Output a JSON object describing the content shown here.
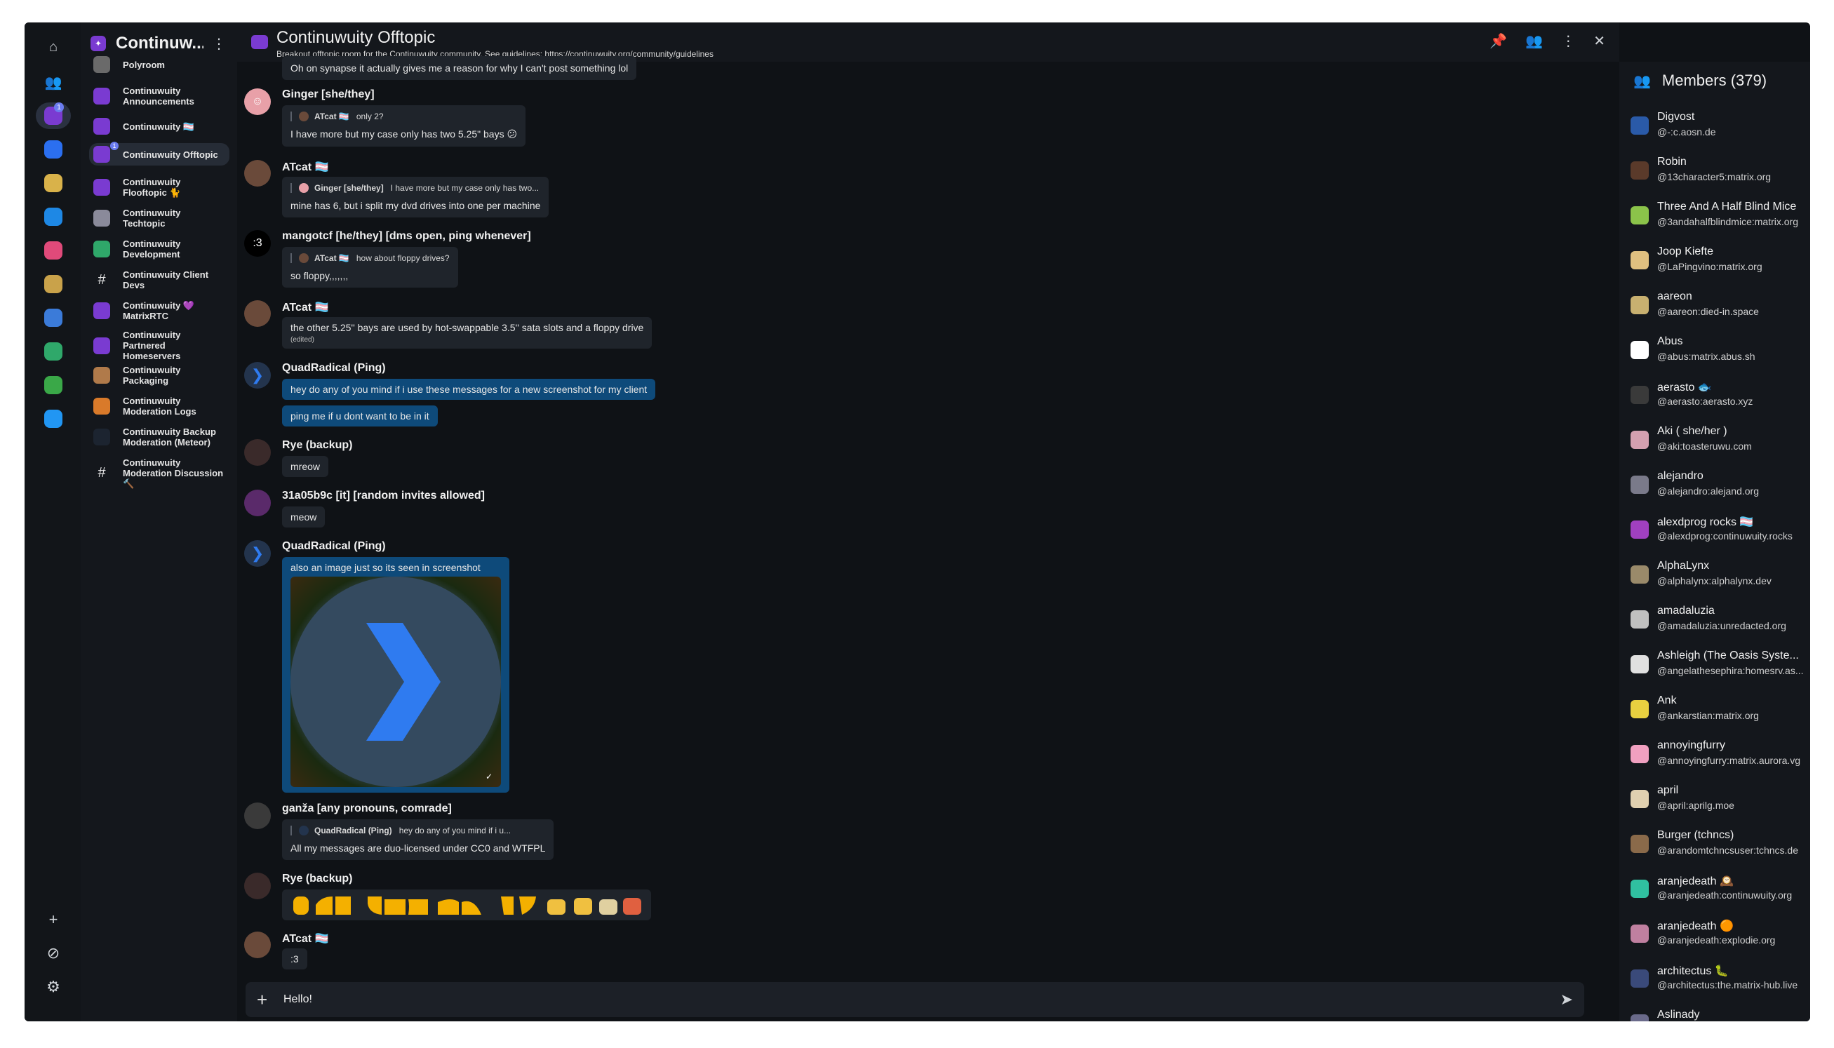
{
  "space": {
    "name": "Continuw...",
    "menu_icon": "kebab-icon"
  },
  "rail": [
    {
      "icon": "home-icon",
      "glyph": "⌂",
      "color": "#cfd3d8"
    },
    {
      "icon": "people-icon",
      "glyph": "👥",
      "color": "#cfd3d8"
    },
    {
      "icon": "continuwuity-space-icon",
      "color": "#7a3bd1",
      "badge": "1",
      "active": true
    },
    {
      "icon": "chat-space-icon",
      "color": "#2b6ff0"
    },
    {
      "icon": "globe-space-icon",
      "color": "#d9b24a"
    },
    {
      "icon": "arrow-space-icon",
      "color": "#1e88e5"
    },
    {
      "icon": "bubble-space-icon",
      "color": "#e04a7a"
    },
    {
      "icon": "tag-space-icon",
      "color": "#c9a24a"
    },
    {
      "icon": "snowflake-space-icon",
      "color": "#3b7bd9"
    },
    {
      "icon": "triangle-space-icon",
      "color": "#2fa86a"
    },
    {
      "icon": "green-space-icon",
      "color": "#3aa848"
    },
    {
      "icon": "bird-space-icon",
      "color": "#2196f3"
    }
  ],
  "rail_bottom": [
    {
      "icon": "add-space-icon",
      "glyph": "+"
    },
    {
      "icon": "explore-icon",
      "glyph": "⊘"
    },
    {
      "icon": "settings-icon",
      "glyph": "⚙"
    }
  ],
  "rooms": [
    {
      "label": "Polyroom",
      "color": "#6a6a6a"
    },
    {
      "label": "Continuwuity Announcements",
      "color": "#7a3bd1"
    },
    {
      "label": "Continuwuity 🏳️‍⚧️",
      "color": "#7a3bd1"
    },
    {
      "label": "Continuwuity Offtopic",
      "color": "#7a3bd1",
      "active": true,
      "badge": "1"
    },
    {
      "label": "Continuwuity Flooftopic 🐈",
      "color": "#7a3bd1"
    },
    {
      "label": "Continuwuity Techtopic",
      "color": "#8a8a9a"
    },
    {
      "label": "Continuwuity Development",
      "color": "#2fa86a"
    },
    {
      "label": "Continuwuity Client Devs",
      "color": "transparent",
      "hash": true
    },
    {
      "label": "Continuwuity 💜 MatrixRTC",
      "color": "#7a3bd1"
    },
    {
      "label": "Continuwuity Partnered Homeservers",
      "color": "#7a3bd1"
    },
    {
      "label": "Continuwuity Packaging",
      "color": "#b07a4a"
    },
    {
      "label": "Continuwuity Moderation Logs",
      "color": "#d97a2a"
    },
    {
      "label": "Continuwuity Backup Moderation (Meteor)",
      "color": "#1c2430"
    },
    {
      "label": "Continuwuity Moderation Discussion 🔨",
      "color": "transparent",
      "hash": true
    }
  ],
  "room": {
    "title": "Continuwuity Offtopic",
    "topic": "Breakout offtopic room for the Continuwuity community. See guidelines: https://continuwuity.org/community/guidelines"
  },
  "messages": {
    "m0": {
      "text": "Oh on synapse it actually gives me a reason for why I can't post something lol"
    },
    "m1": {
      "sender": "Ginger [she/they]",
      "reply_name": "ATcat 🏳️‍⚧️",
      "reply_text": "only 2?",
      "text": "I have more but my case only has two 5.25\" bays 😕"
    },
    "m2": {
      "sender": "ATcat 🏳️‍⚧️",
      "reply_name": "Ginger [she/they]",
      "reply_text": "I have more but my case only has two...",
      "text": "mine has 6, but i split my dvd drives into one per machine"
    },
    "m3": {
      "sender": "mangotcf [he/they] [dms open, ping whenever]",
      "avatar": ":3",
      "reply_name": "ATcat 🏳️‍⚧️",
      "reply_text": "how about floppy drives?",
      "text": "so floppy,,,,,,,"
    },
    "m4": {
      "sender": "ATcat 🏳️‍⚧️",
      "text": "the other 5.25'' bays are used by hot-swappable 3.5'' sata slots and a floppy drive",
      "edited": "(edited)"
    },
    "m5": {
      "sender": "QuadRadical (Ping)",
      "text1": "hey do any of you mind if i use these messages for a new screenshot for my client",
      "text2": "ping me if u dont want to be in it"
    },
    "m6": {
      "sender": "Rye (backup)",
      "text": "mreow"
    },
    "m7": {
      "sender": "31a05b9c [it] [random invites allowed]",
      "text": "meow"
    },
    "m8": {
      "sender": "QuadRadical (Ping)",
      "text": "also an image just so its seen in screenshot"
    },
    "m9": {
      "sender": "ganža [any pronouns, comrade]",
      "reply_name": "QuadRadical (Ping)",
      "reply_text": "hey do any of you mind if i u...",
      "text": "All my messages are duo-licensed under CC0 and WTFPL"
    },
    "m10": {
      "sender": "Rye (backup)",
      "text": "emoji-row"
    },
    "m11": {
      "sender": "ATcat 🏳️‍⚧️",
      "text": ":3"
    }
  },
  "composer": {
    "value": "Hello!",
    "plus_icon": "plus-icon",
    "send_icon": "send-icon"
  },
  "members": {
    "header": "Members (379)",
    "list": [
      {
        "name": "Digvost",
        "id": "@-:c.aosn.de",
        "color": "#2a5aa8"
      },
      {
        "name": "Robin",
        "id": "@13character5:matrix.org",
        "color": "#5a3a2a"
      },
      {
        "name": "Three And A Half Blind Mice",
        "id": "@3andahalfblindmice:matrix.org",
        "color": "#8bc34a"
      },
      {
        "name": "Joop Kiefte",
        "id": "@LaPingvino:matrix.org",
        "color": "#e0c080"
      },
      {
        "name": "aareon",
        "id": "@aareon:died-in.space",
        "color": "#c8b070"
      },
      {
        "name": "Abus",
        "id": "@abus:matrix.abus.sh",
        "color": "#ffffff"
      },
      {
        "name": "aerasto 🐟",
        "id": "@aerasto:aerasto.xyz",
        "color": "#3a3a3a"
      },
      {
        "name": "Aki ( she/her )",
        "id": "@aki:toasteruwu.com",
        "color": "#d4a0b0"
      },
      {
        "name": "alejandro",
        "id": "@alejandro:alejand.org",
        "color": "#7a7a8a"
      },
      {
        "name": "alexdprog rocks 🏳️‍⚧️",
        "id": "@alexdprog:continuwuity.rocks",
        "color": "#a040c0"
      },
      {
        "name": "AlphaLynx",
        "id": "@alphalynx:alphalynx.dev",
        "color": "#9a8a6a"
      },
      {
        "name": "amadaluzia",
        "id": "@amadaluzia:unredacted.org",
        "color": "#c0c0c0"
      },
      {
        "name": "Ashleigh (The Oasis Syste...",
        "id": "@angelathesephira:homesrv.as...",
        "color": "#e0e0e0"
      },
      {
        "name": "Ank",
        "id": "@ankarstian:matrix.org",
        "color": "#e8d040"
      },
      {
        "name": "annoyingfurry",
        "id": "@annoyingfurry:matrix.aurora.vg",
        "color": "#f0a0c0"
      },
      {
        "name": "april",
        "id": "@april:aprilg.moe",
        "color": "#e0d0b0"
      },
      {
        "name": "Burger (tchncs)",
        "id": "@arandomtchncsuser:tchncs.de",
        "color": "#8a6a4a"
      },
      {
        "name": "aranjedeath 🕰️",
        "id": "@aranjedeath:continuwuity.org",
        "color": "#30c0a0"
      },
      {
        "name": "aranjedeath 🟠",
        "id": "@aranjedeath:explodie.org",
        "color": "#c080a0"
      },
      {
        "name": "architectus 🐛",
        "id": "@architectus:the.matrix-hub.live",
        "color": "#3a4a7a"
      },
      {
        "name": "Aslinady",
        "id": "",
        "color": "#6a6a8a"
      }
    ]
  },
  "header_icons": [
    "pin-icon",
    "members-icon",
    "kebab-icon",
    "close-icon"
  ]
}
